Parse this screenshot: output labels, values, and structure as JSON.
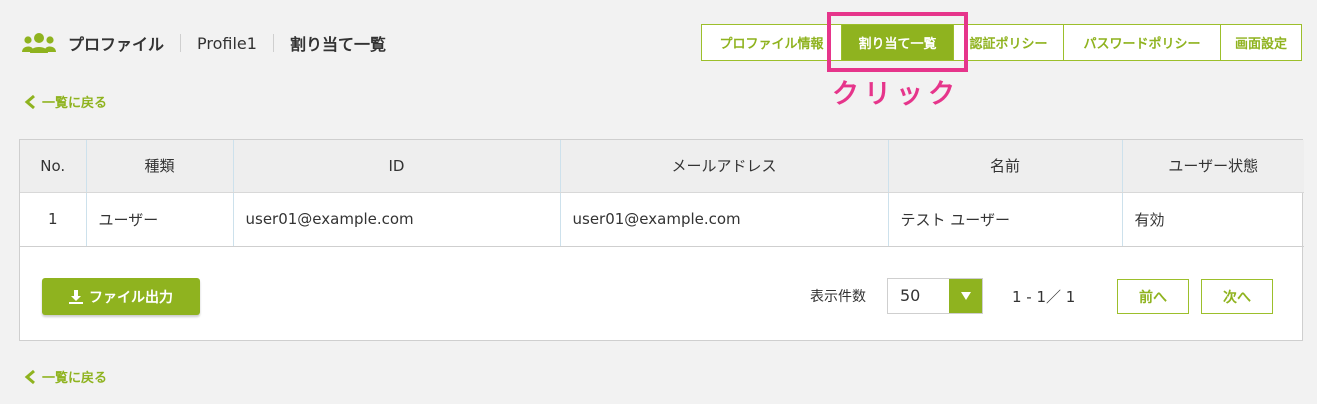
{
  "breadcrumb": {
    "section": "プロファイル",
    "profile": "Profile1",
    "current": "割り当て一覧"
  },
  "tabs": [
    {
      "label": "プロファイル情報",
      "active": false
    },
    {
      "label": "割り当て一覧",
      "active": true
    },
    {
      "label": "認証ポリシー",
      "active": false
    },
    {
      "label": "パスワードポリシー",
      "active": false
    },
    {
      "label": "画面設定",
      "active": false
    }
  ],
  "annotation": {
    "text": "クリック",
    "color": "#e6358b"
  },
  "back_link": "一覧に戻る",
  "table": {
    "headers": [
      "No.",
      "種類",
      "ID",
      "メールアドレス",
      "名前",
      "ユーザー状態"
    ],
    "rows": [
      [
        "1",
        "ユーザー",
        "user01@example.com",
        "user01@example.com",
        "テスト ユーザー",
        "有効"
      ]
    ]
  },
  "footer": {
    "export_label": "ファイル出力",
    "per_page_label": "表示件数",
    "per_page_value": "50",
    "pager_info": "1 - 1／ 1",
    "prev_label": "前へ",
    "next_label": "次へ"
  },
  "colors": {
    "accent": "#8fb31f",
    "highlight": "#e6358b"
  }
}
